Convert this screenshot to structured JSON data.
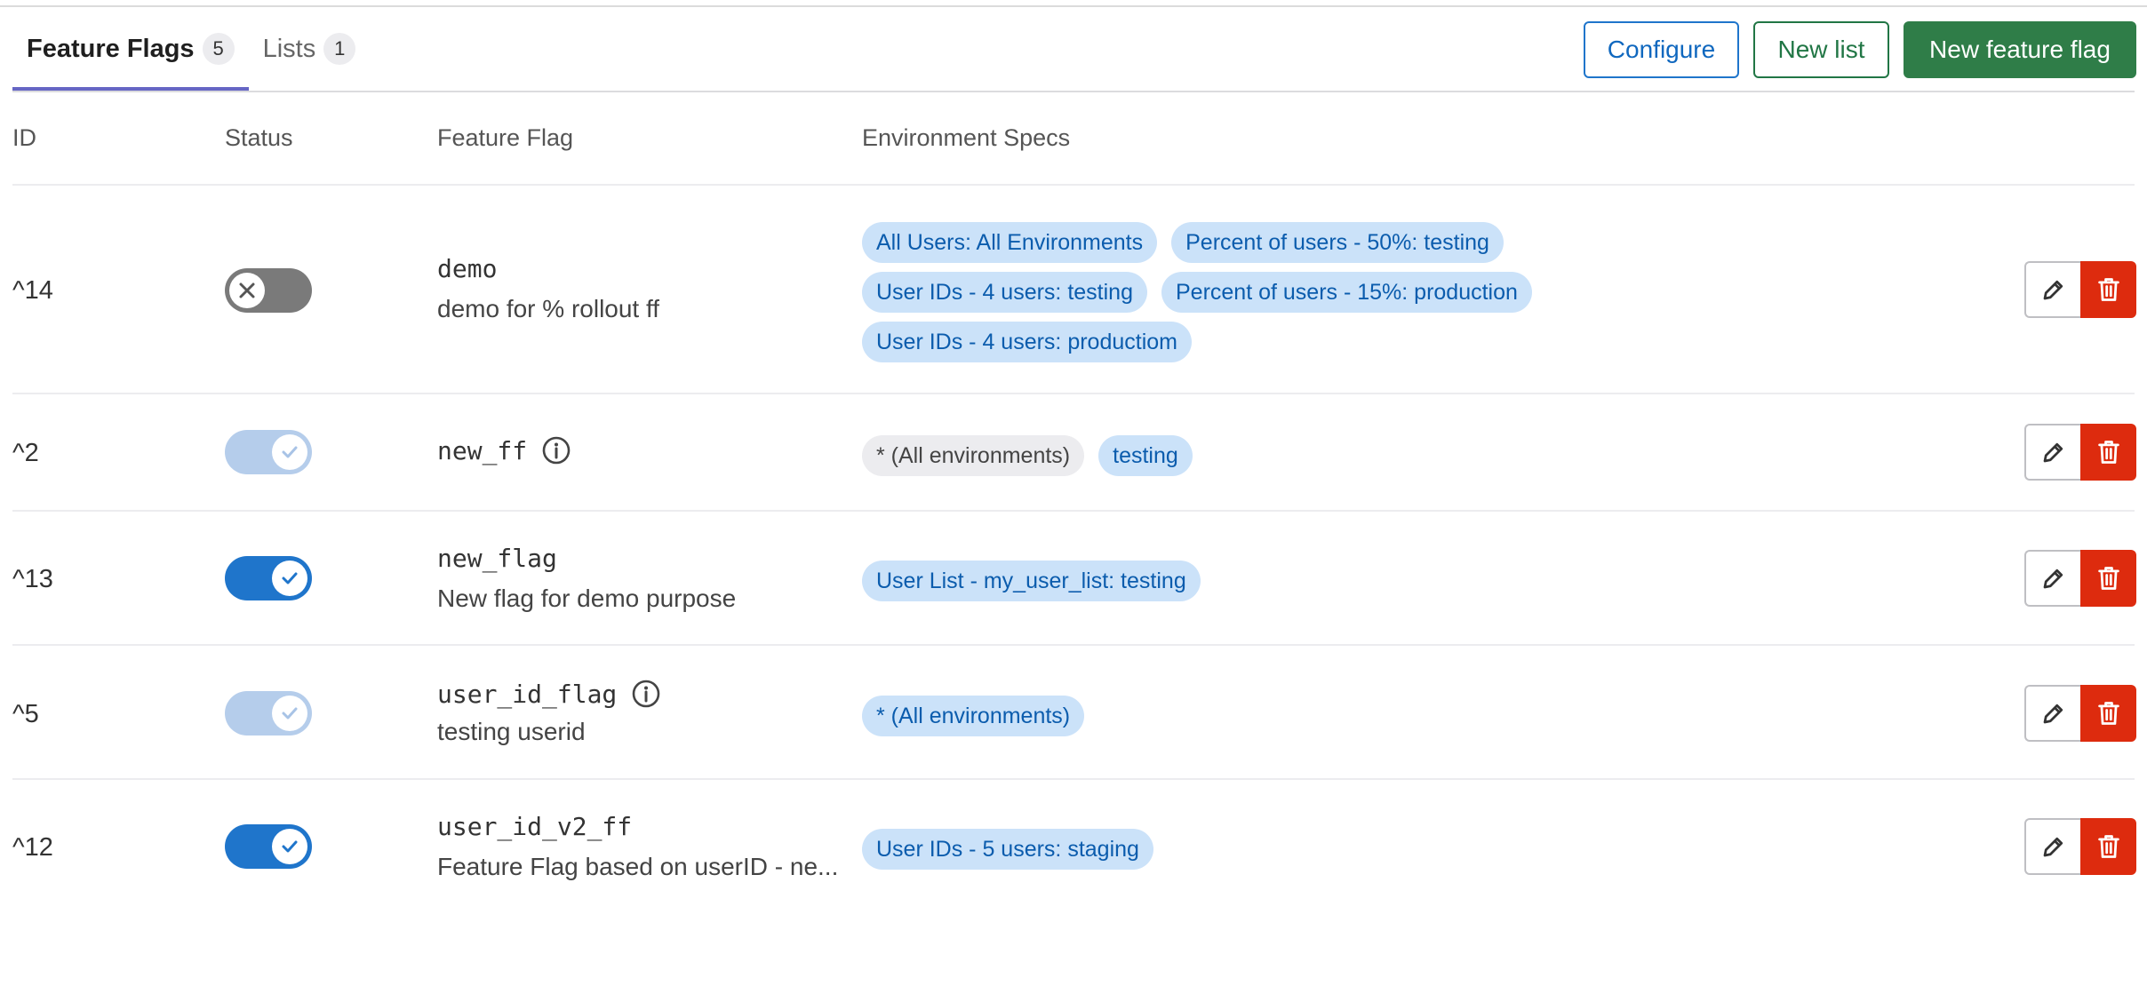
{
  "tabs": [
    {
      "label": "Feature Flags",
      "count": "5"
    },
    {
      "label": "Lists",
      "count": "1"
    }
  ],
  "buttons": {
    "configure": "Configure",
    "new_list": "New list",
    "new_feature_flag": "New feature flag"
  },
  "table": {
    "headers": {
      "id": "ID",
      "status": "Status",
      "feature_flag": "Feature Flag",
      "environment_specs": "Environment Specs"
    },
    "rows": [
      {
        "id": "^14",
        "status": "off",
        "name": "demo",
        "description": "demo for % rollout ff",
        "has_info": false,
        "env_specs": [
          "All Users: All Environments",
          "Percent of users - 50%: testing",
          "User IDs - 4 users: testing",
          "Percent of users - 15%: production",
          "User IDs - 4 users: productiom"
        ]
      },
      {
        "id": "^2",
        "status": "on-disabled",
        "name": "new_ff",
        "description": "",
        "has_info": true,
        "env_specs": [
          "* (All environments)",
          "testing"
        ]
      },
      {
        "id": "^13",
        "status": "on",
        "name": "new_flag",
        "description": "New flag for demo purpose",
        "has_info": false,
        "env_specs": [
          "User List - my_user_list: testing"
        ]
      },
      {
        "id": "^5",
        "status": "on-disabled",
        "name": "user_id_flag",
        "description": "testing userid",
        "has_info": true,
        "env_specs": [
          "* (All environments)"
        ]
      },
      {
        "id": "^12",
        "status": "on",
        "name": "user_id_v2_ff",
        "description": "Feature Flag based on userID - ne...",
        "has_info": false,
        "env_specs": [
          "User IDs - 5 users: staging"
        ]
      }
    ]
  },
  "icons": {
    "edit": "pencil-icon",
    "delete": "trash-icon",
    "info": "info-circle-icon",
    "toggle_on": "check-icon",
    "toggle_off": "close-icon"
  },
  "colors": {
    "tab_underline": "#6666c4",
    "primary_blue": "#1f75cb",
    "toggle_disabled": "#b5cdeb",
    "toggle_off": "#7a7a7a",
    "new_flag_green": "#2f7d48",
    "delete_red": "#dd2b0e",
    "badge_blue_bg": "#cbe2f9",
    "badge_neutral_bg": "#ececef"
  }
}
